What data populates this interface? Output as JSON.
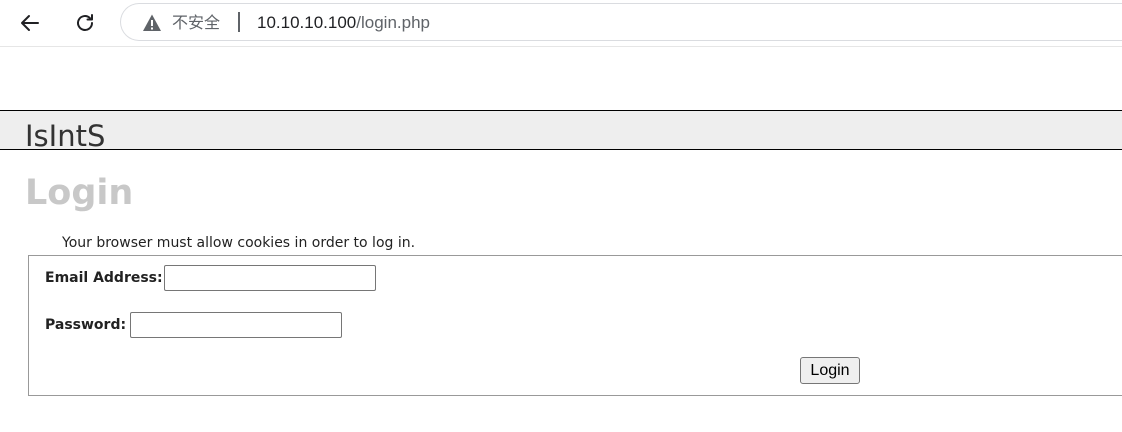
{
  "browser": {
    "security_label": "不安全",
    "url_host": "10.10.10.100",
    "url_path": "/login.php"
  },
  "site": {
    "title": "IsIntS"
  },
  "page": {
    "heading": "Login",
    "cookie_note": "Your browser must allow cookies in order to log in."
  },
  "form": {
    "email_label": "Email Address:",
    "email_value": "",
    "password_label": "Password:",
    "password_value": "",
    "submit_label": "Login"
  },
  "icons": {
    "back": "arrow-left-icon",
    "reload": "reload-icon",
    "warning": "warning-triangle-icon"
  },
  "colors": {
    "heading": "#c8c8c8",
    "header_bar": "#eeeeee"
  }
}
